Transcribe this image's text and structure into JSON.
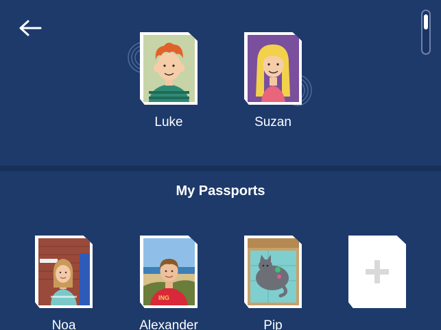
{
  "nav": {
    "back_icon": "arrow-left-icon"
  },
  "profiles": [
    {
      "name": "Luke",
      "avatar": "cartoon-boy-avatar"
    },
    {
      "name": "Suzan",
      "avatar": "cartoon-girl-avatar"
    }
  ],
  "passports": {
    "title": "My Passports",
    "items": [
      {
        "name": "Noa"
      },
      {
        "name": "Alexander"
      },
      {
        "name": "Pip"
      }
    ],
    "add_icon": "plus-icon"
  },
  "colors": {
    "background": "#1d3a6b",
    "divider": "#17305a",
    "card": "#ffffff",
    "luke_bg": "#c7d4a7",
    "suzan_bg": "#7a4f9e",
    "add_plus": "#d9d9d9"
  }
}
